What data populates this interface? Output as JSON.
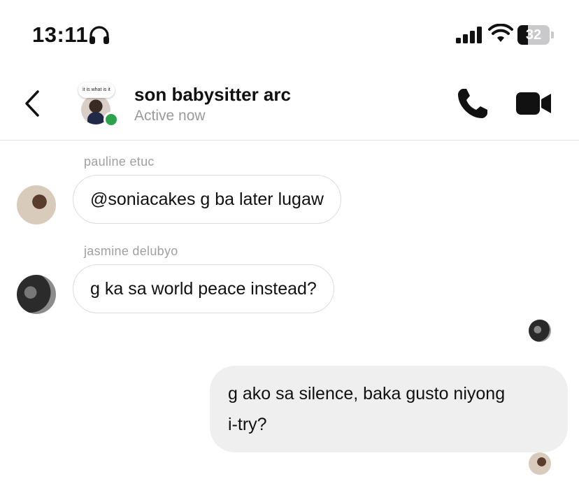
{
  "status_bar": {
    "time": "13:11",
    "battery": "32",
    "battery_level": 0.32,
    "icons": [
      "headphones-icon",
      "cellular-signal-icon",
      "wifi-icon",
      "battery-icon"
    ]
  },
  "header": {
    "back_icon": "chevron-left-icon",
    "group_note": "it is what is it",
    "title": "son babysitter arc",
    "status": "Active now",
    "call_icon": "phone-icon",
    "video_icon": "video-camera-icon",
    "online_color": "#2aa34a"
  },
  "messages": [
    {
      "sender": "pauline etuc",
      "mention": "@soniacakes",
      "text": " g ba later lugaw"
    },
    {
      "sender": "jasmine delubyo",
      "text": "g ka sa world peace instead?"
    },
    {
      "sender": "me",
      "line1": "g ako sa silence, baka gusto niyong",
      "line2": "i-try?"
    }
  ],
  "colors": {
    "outgoing_bubble": "#efefef",
    "incoming_border": "#dcdcdc",
    "secondary_text": "#9a9a9a"
  }
}
